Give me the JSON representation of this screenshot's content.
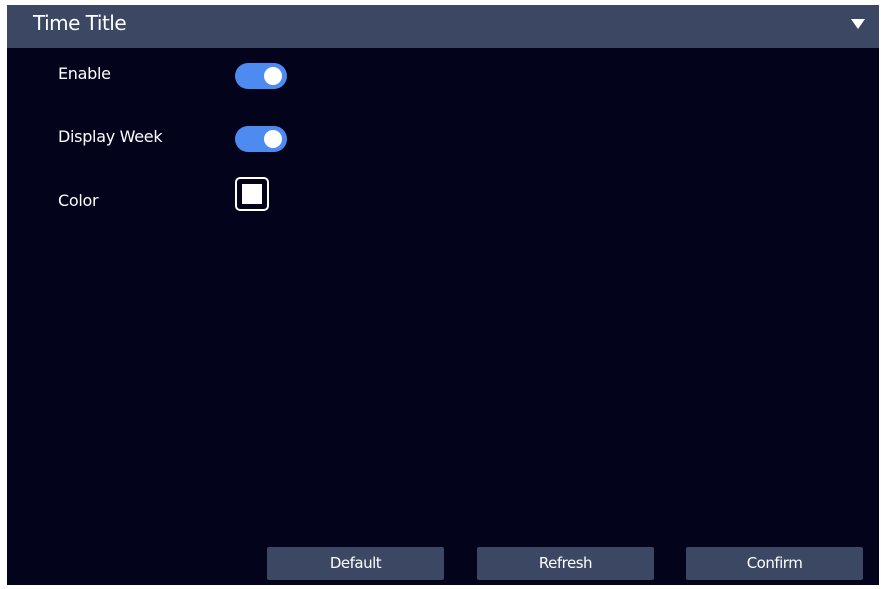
{
  "header": {
    "title": "Time Title",
    "collapse_icon": "triangle-down-icon"
  },
  "settings": {
    "enable": {
      "label": "Enable",
      "on": true
    },
    "display_week": {
      "label": "Display Week",
      "on": true
    },
    "color": {
      "label": "Color",
      "value": "#ffffff"
    }
  },
  "colors": {
    "background": "#03031c",
    "header": "#3b4763",
    "toggle_on": "#4d8bf0",
    "button": "#3b4763",
    "text": "#ffffff"
  },
  "buttons": {
    "default_label": "Default",
    "refresh_label": "Refresh",
    "confirm_label": "Confirm"
  }
}
